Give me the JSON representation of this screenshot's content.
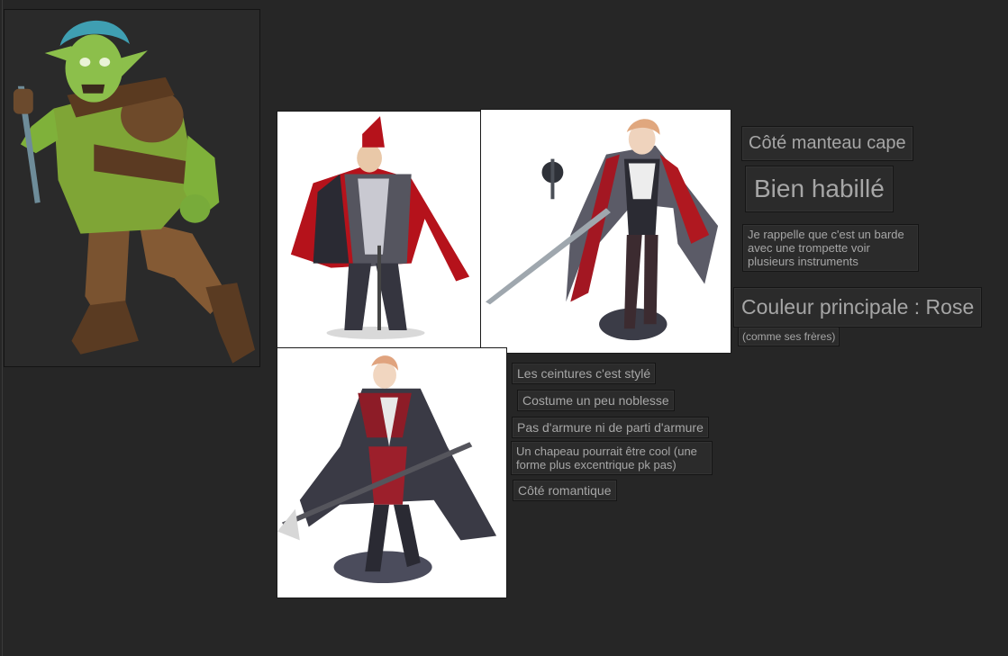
{
  "images": {
    "goblin": "goblin character illustration",
    "ref1": "red caped knight character",
    "ref2": "bard with sword and cape",
    "ref3": "noble in red coat with spear"
  },
  "notes": {
    "cape": "Côté manteau cape",
    "habille": "Bien habillé",
    "barde": "Je rappelle que c'est un barde avec une trompette voir plusieurs instruments",
    "couleur": "Couleur principale : Rose",
    "freres": "(comme ses frères)",
    "ceintures": "Les ceintures c'est stylé",
    "noblesse": "Costume un peu noblesse",
    "armure": "Pas d'armure ni de parti d'armure",
    "chapeau": "Un chapeau pourrait être cool (une forme plus excentrique pk pas)",
    "romantique": "Côté romantique"
  },
  "colors": {
    "canvas": "#262626",
    "note_bg": "#2b2b2b",
    "note_text": "#a6a6a6"
  }
}
